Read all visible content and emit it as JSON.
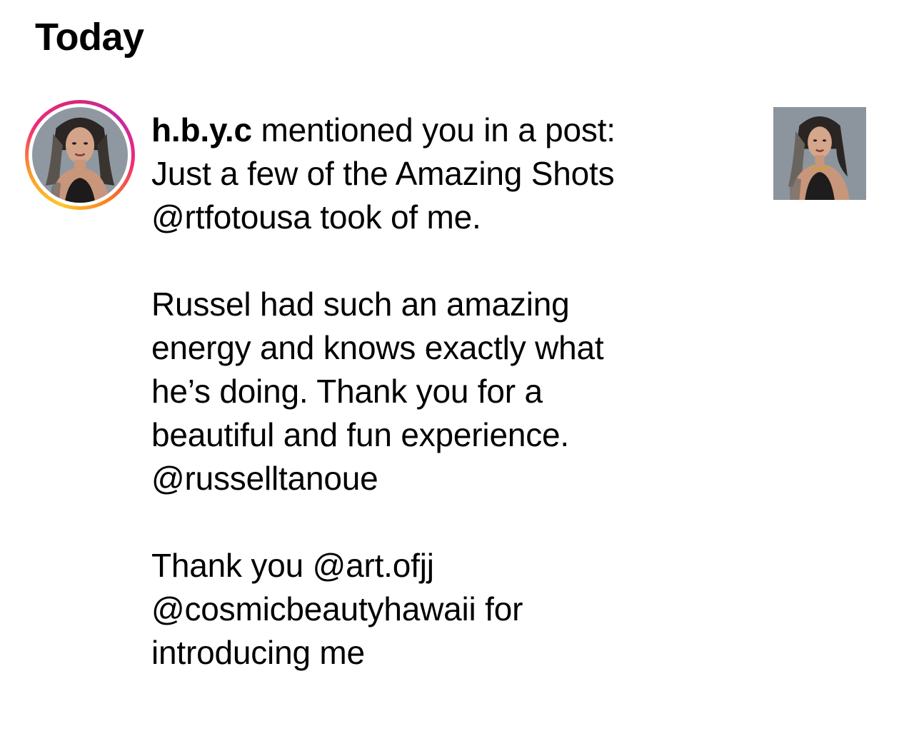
{
  "section": {
    "title": "Today"
  },
  "notification": {
    "username": "h.b.y.c",
    "action": " mentioned you in a post:",
    "paragraphs": [
      [
        "Just a few of the Amazing Shots",
        "@rtfotousa took of me."
      ],
      [
        "Russel had such an amazing",
        "energy and knows exactly what",
        "he’s doing. Thank you for a",
        "beautiful and fun experience.",
        "@russelltanoue"
      ],
      [
        "Thank you @art.ofjj",
        "@cosmicbeautyhawaii for",
        "introducing me"
      ]
    ],
    "avatar_icon": "profile-photo",
    "thumbnail_icon": "post-thumbnail",
    "ring_colors": [
      "#fdc62a",
      "#fa7e1e",
      "#d62976",
      "#c32aa3"
    ]
  }
}
